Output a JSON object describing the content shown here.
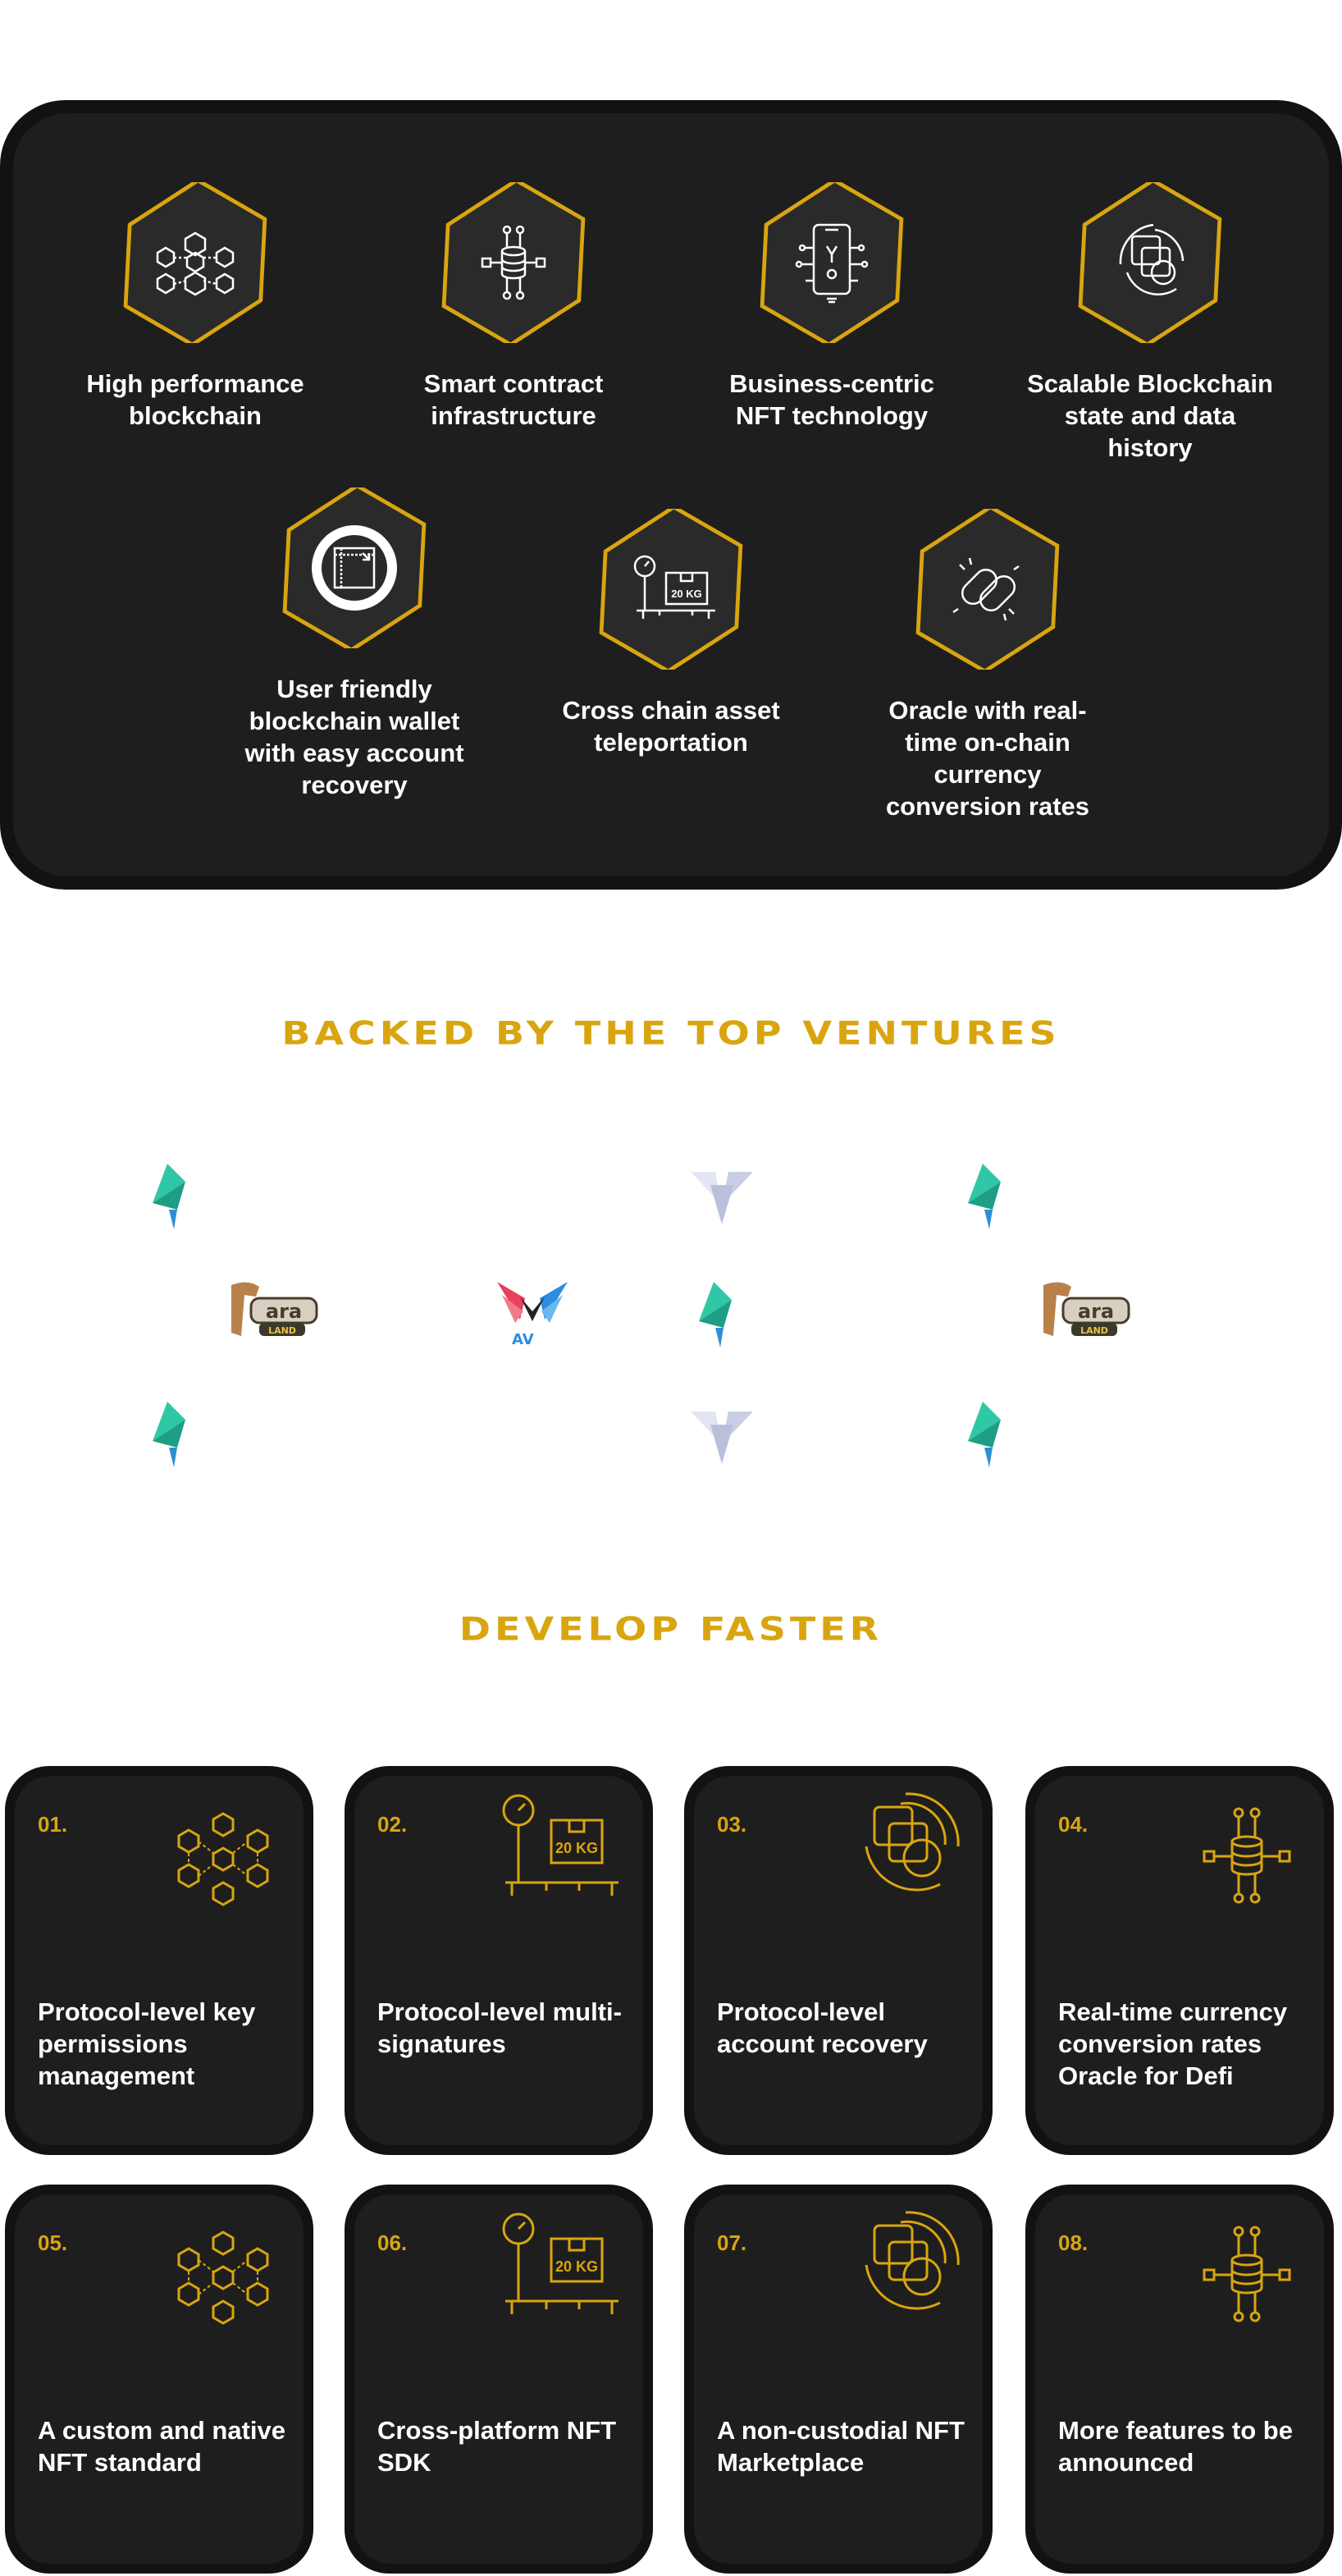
{
  "features": [
    {
      "label": "High performance blockchain",
      "icon": "network-cubes-icon"
    },
    {
      "label": "Smart contract infrastructure",
      "icon": "database-nodes-icon"
    },
    {
      "label": "Business-centric NFT technology",
      "icon": "phone-circuit-icon"
    },
    {
      "label": "Scalable Blockchain state and data history",
      "icon": "layers-arc-icon"
    },
    {
      "label": "User friendly blockchain wallet with easy account recovery",
      "icon": "wallet-square-icon"
    },
    {
      "label": "Cross chain asset teleportation",
      "icon": "scale-box-icon",
      "badge": "20 KG"
    },
    {
      "label": "Oracle with real-time on-chain currency conversion rates",
      "icon": "chain-link-icon"
    }
  ],
  "ventures": {
    "title": "BACKED BY THE TOP VENTURES",
    "logos": [
      "teal-leaf-logo",
      "white-v-logo",
      "teal-leaf-logo",
      "tara-land-logo",
      "av-wings-logo",
      "teal-leaf-logo",
      "tara-land-logo",
      "teal-leaf-logo",
      "white-v-logo",
      "teal-leaf-logo"
    ],
    "tara_text": "ara",
    "tara_sub": "LAND",
    "av_text": "AV"
  },
  "develop": {
    "title": "DEVELOP FASTER",
    "cards": [
      {
        "num": "01.",
        "label": "Protocol-level key permissions management",
        "icon": "network-cubes-icon"
      },
      {
        "num": "02.",
        "label": "Protocol-level multi-signatures",
        "icon": "scale-box-icon",
        "badge": "20 KG"
      },
      {
        "num": "03.",
        "label": "Protocol-level account recovery",
        "icon": "layers-arc-icon"
      },
      {
        "num": "04.",
        "label": "Real-time currency conversion rates Oracle for Defi",
        "icon": "database-nodes-icon"
      },
      {
        "num": "05.",
        "label": "A custom and native NFT standard",
        "icon": "network-cubes-icon"
      },
      {
        "num": "06.",
        "label": "Cross-platform NFT SDK",
        "icon": "scale-box-icon",
        "badge": "20 KG"
      },
      {
        "num": "07.",
        "label": "A non-custodial NFT Marketplace",
        "icon": "layers-arc-icon"
      },
      {
        "num": "08.",
        "label": "More features to be announced",
        "icon": "database-nodes-icon"
      }
    ]
  },
  "colors": {
    "gold": "#d9a50f",
    "panel": "#1e1e1e",
    "panel_border": "#121212",
    "text": "#ffffff"
  }
}
